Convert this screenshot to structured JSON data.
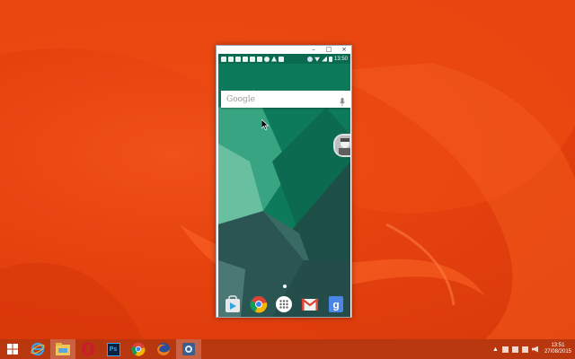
{
  "window": {
    "minimize_glyph": "–",
    "maximize_glyph": "□",
    "close_glyph": "×"
  },
  "phone": {
    "status_time": "13:50",
    "search_placeholder": "Google",
    "dock_apps": [
      "play-store-icon",
      "chrome-icon",
      "app-drawer-icon",
      "gmail-icon",
      "google-search-icon"
    ]
  },
  "taskbar": {
    "items": [
      "windows-start-icon",
      "internet-explorer-icon",
      "file-explorer-icon",
      "opera-icon",
      "photoshop-icon",
      "chrome-icon",
      "firefox-icon",
      "emulator-app-icon"
    ],
    "photoshop_label": "Ps",
    "clock_time": "13:51",
    "clock_date": "27/08/2015"
  },
  "colors": {
    "wallpaper": "#e5420e",
    "taskbar": "#b9370f",
    "phone_wallpaper": "#0e7a5c"
  }
}
